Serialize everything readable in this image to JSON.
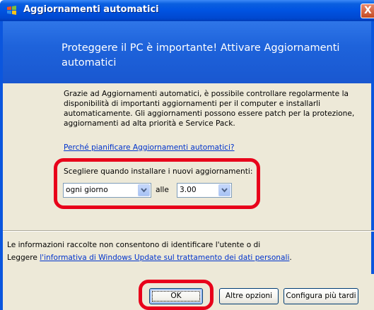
{
  "window": {
    "title": "Aggiornamenti automatici",
    "close_label": "X"
  },
  "header": {
    "title": "Proteggere il PC è importante! Attivare Aggiornamenti automatici"
  },
  "body": {
    "description": "Grazie ad Aggiornamenti automatici, è possibile controllare regolarmente la disponibilità di importanti aggiornamenti per il computer e installarli automaticamente. Gli aggiornamenti possono essere patch per la protezione, aggiornamenti ad alta priorità e Service Pack.",
    "why_link": "Perché pianificare Aggiornamenti automatici?",
    "schedule_label": "Scegliere quando installare i nuovi aggiornamenti:",
    "day_select": {
      "value": "ogni giorno"
    },
    "at_label": "alle",
    "time_select": {
      "value": "3.00"
    }
  },
  "info": {
    "line1": "Le informazioni raccolte non consentono di identificare l'utente o di",
    "line2_prefix": "Leggere ",
    "line2_link": "l'informativa di Windows Update sul trattamento dei dati personali",
    "line2_suffix": "."
  },
  "buttons": {
    "ok": "OK",
    "more_options": "Altre opzioni",
    "later": "Configura più tardi"
  },
  "colors": {
    "highlight": "#e8001a",
    "titlebar": "#0053e1",
    "panel": "#ede9d8"
  }
}
